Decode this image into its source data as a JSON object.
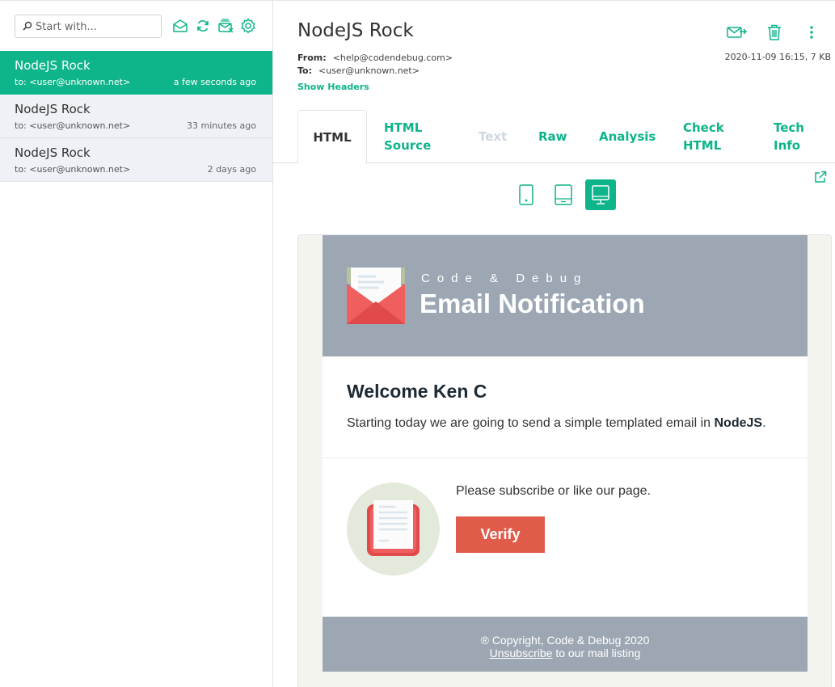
{
  "search": {
    "placeholder": "Start with..."
  },
  "toolbar_icons": [
    "mark-read-icon",
    "refresh-icon",
    "clear-inbox-icon",
    "settings-icon"
  ],
  "messages": [
    {
      "subject": "NodeJS Rock",
      "to": "to: <user@unknown.net>",
      "time": "a few seconds ago",
      "active": true
    },
    {
      "subject": "NodeJS Rock",
      "to": "to: <user@unknown.net>",
      "time": "33 minutes ago",
      "active": false
    },
    {
      "subject": "NodeJS Rock",
      "to": "to: <user@unknown.net>",
      "time": "2 days ago",
      "active": false
    }
  ],
  "header": {
    "subject": "NodeJS Rock",
    "from_label": "From:",
    "from_value": "<help@codendebug.com>",
    "to_label": "To:",
    "to_value": "<user@unknown.net>",
    "date_size": "2020-11-09 16:15, 7 KB",
    "show_headers": "Show Headers"
  },
  "tabs": {
    "html": "HTML",
    "html_source": "HTML Source",
    "text": "Text",
    "raw": "Raw",
    "analysis": "Analysis",
    "check_html": "Check HTML",
    "tech_info": "Tech Info"
  },
  "email": {
    "brand": "Code & Debug",
    "title": "Email Notification",
    "welcome": "Welcome Ken C",
    "intro": "Starting today we are going to send a simple templated email in",
    "intro_bold": "NodeJS",
    "intro_end": ".",
    "subscribe": "Please subscribe or like our page.",
    "verify": "Verify",
    "copyright": "® Copyright, Code & Debug 2020",
    "unsubscribe": "Unsubscribe",
    "unsubscribe_rest": " to our mail listing"
  },
  "colors": {
    "accent": "#0eb48a",
    "email_header": "#9ca7b3",
    "verify_button": "#e05b4a"
  }
}
